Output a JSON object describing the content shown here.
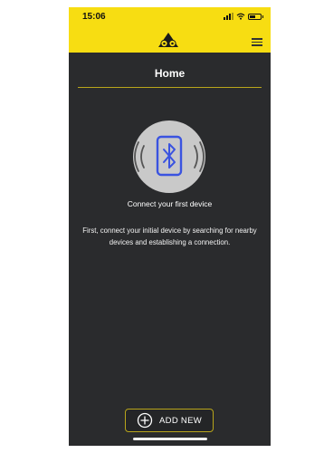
{
  "status_bar": {
    "time": "15:06"
  },
  "header": {
    "title": "Home"
  },
  "connect": {
    "headline": "Connect your first device",
    "description": "First, connect your initial device by searching for nearby devices and establishing a connection."
  },
  "actions": {
    "add_new_label": "ADD NEW"
  },
  "colors": {
    "accent": "#f7dd12",
    "background": "#2a2b2d",
    "bluetooth": "#3a53e0",
    "divider": "#b8a51b"
  }
}
